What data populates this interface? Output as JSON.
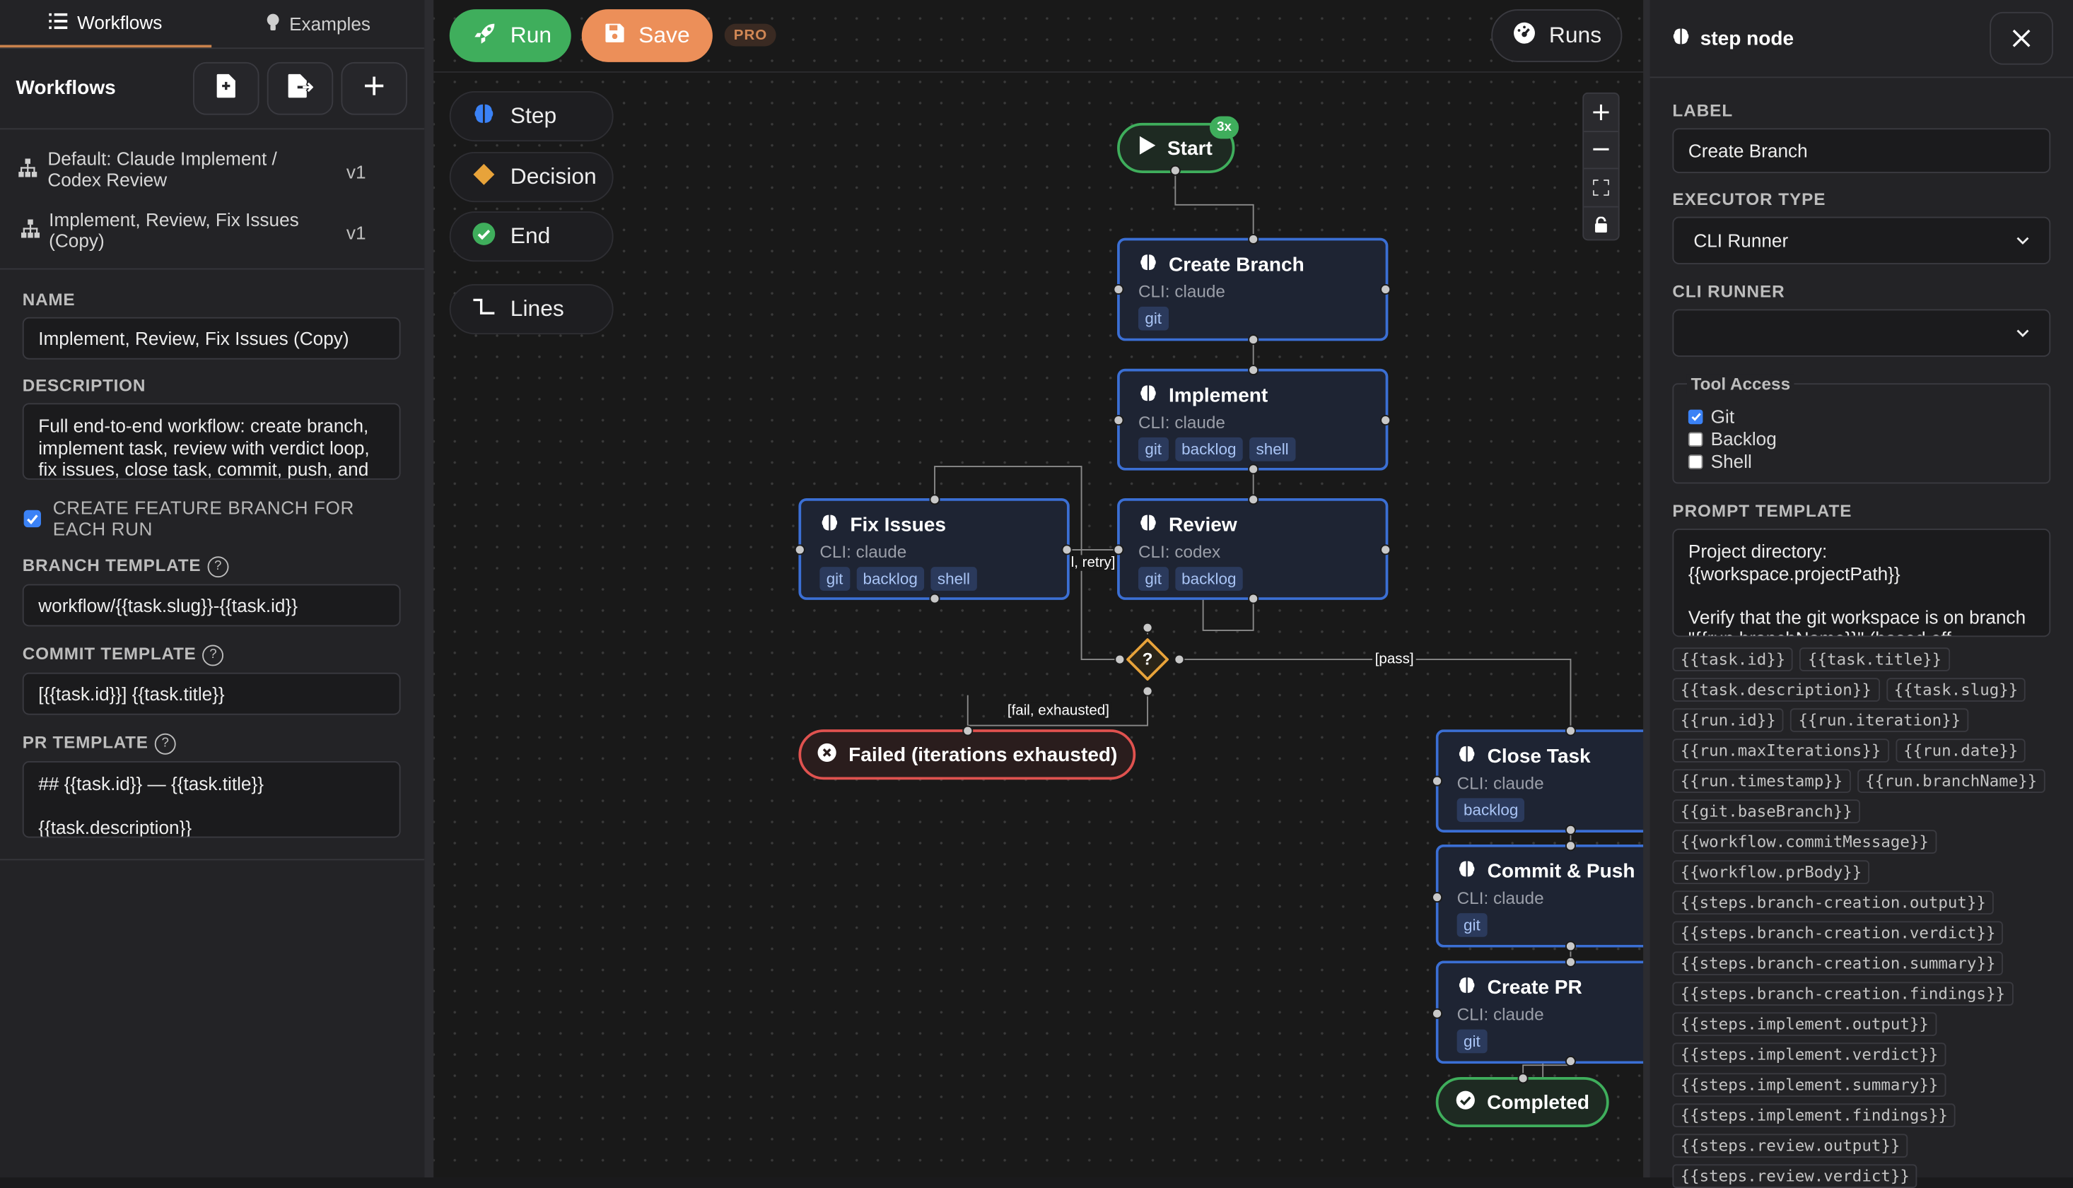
{
  "left_tabs": [
    {
      "label": "Workflows"
    },
    {
      "label": "Examples"
    }
  ],
  "workflows_title": "Workflows",
  "workflow_list": [
    {
      "name": "Default: Claude Implement / Codex Review",
      "version": "v1"
    },
    {
      "name": "Implement, Review, Fix Issues (Copy)",
      "version": "v1"
    }
  ],
  "form": {
    "name_label": "NAME",
    "name_value": "Implement, Review, Fix Issues (Copy)",
    "description_label": "DESCRIPTION",
    "description_value": "Full end-to-end workflow: create branch, implement task, review with verdict loop, fix issues, close task, commit, push, and",
    "feature_branch_label": "CREATE FEATURE BRANCH FOR EACH RUN",
    "branch_template_label": "BRANCH TEMPLATE",
    "branch_template_value": "workflow/{{task.slug}}-{{task.id}}",
    "commit_template_label": "COMMIT TEMPLATE",
    "commit_template_value": "[{{task.id}}] {{task.title}}",
    "pr_template_label": "PR TEMPLATE",
    "pr_template_line1": "## {{task.id}} — {{task.title}}",
    "pr_template_line2": "{{task.description}}"
  },
  "toolbar": {
    "run": "Run",
    "save": "Save",
    "pro": "PRO",
    "runs": "Runs"
  },
  "palette": [
    {
      "label": "Step"
    },
    {
      "label": "Decision"
    },
    {
      "label": "End"
    },
    {
      "label": "Lines"
    }
  ],
  "graph": {
    "start": {
      "label": "Start",
      "badge": "3x"
    },
    "nodes": [
      {
        "title": "Create Branch",
        "sub": "CLI: claude",
        "tags": [
          "git"
        ]
      },
      {
        "title": "Implement",
        "sub": "CLI: claude",
        "tags": [
          "git",
          "backlog",
          "shell"
        ]
      },
      {
        "title": "Fix Issues",
        "sub": "CLI: claude",
        "tags": [
          "git",
          "backlog",
          "shell"
        ]
      },
      {
        "title": "Review",
        "sub": "CLI: codex",
        "tags": [
          "git",
          "backlog"
        ]
      },
      {
        "title": "Close Task",
        "sub": "CLI: claude",
        "tags": [
          "backlog"
        ]
      },
      {
        "title": "Commit & Push",
        "sub": "CLI: claude",
        "tags": [
          "git"
        ]
      },
      {
        "title": "Create PR",
        "sub": "CLI: claude",
        "tags": [
          "git"
        ]
      }
    ],
    "decision_label": "?",
    "failed_label": "Failed (iterations exhausted)",
    "completed_label": "Completed",
    "edge_labels": {
      "retry": "l, retry]",
      "fail": "[fail, exhausted]",
      "pass": "[pass]"
    }
  },
  "panel": {
    "title": "step node",
    "label_label": "LABEL",
    "label_value": "Create Branch",
    "executor_label": "EXECUTOR TYPE",
    "executor_value": "CLI Runner",
    "runner_label": "CLI RUNNER",
    "runner_value": "",
    "tool_access_label": "Tool Access",
    "tools": [
      {
        "label": "Git",
        "checked": true
      },
      {
        "label": "Backlog",
        "checked": false
      },
      {
        "label": "Shell",
        "checked": false
      }
    ],
    "prompt_label": "PROMPT TEMPLATE",
    "prompt_value": "Project directory:\n{{workspace.projectPath}}\n\nVerify that the git workspace is on branch \"{{run.branchName}}\" (based off",
    "variables": [
      "{{task.id}}",
      "{{task.title}}",
      "{{task.description}}",
      "{{task.slug}}",
      "{{run.id}}",
      "{{run.iteration}}",
      "{{run.maxIterations}}",
      "{{run.date}}",
      "{{run.timestamp}}",
      "{{run.branchName}}",
      "{{git.baseBranch}}",
      "{{workflow.commitMessage}}",
      "{{workflow.prBody}}",
      "{{steps.branch-creation.output}}",
      "{{steps.branch-creation.verdict}}",
      "{{steps.branch-creation.summary}}",
      "{{steps.branch-creation.findings}}",
      "{{steps.implement.output}}",
      "{{steps.implement.verdict}}",
      "{{steps.implement.summary}}",
      "{{steps.implement.findings}}",
      "{{steps.review.output}}",
      "{{steps.review.verdict}}"
    ]
  },
  "colors": {
    "run": "#3fae5c",
    "save": "#ec8f59",
    "node_border": "#3b6fd4",
    "decision": "#e8a33a",
    "failed": "#e0524f",
    "completed": "#3fae5c"
  }
}
